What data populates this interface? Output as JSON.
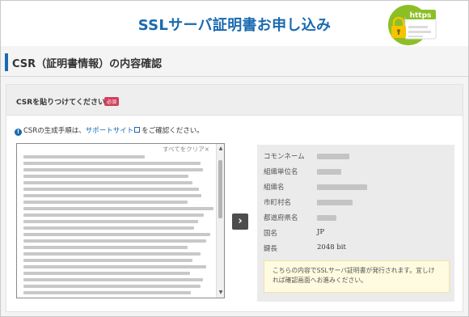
{
  "header": {
    "title": "SSLサーバ証明書お申し込み",
    "badge_text": "https",
    "colors": {
      "brand": "#1a6ab0",
      "badge_green": "#8cbf26"
    }
  },
  "section": {
    "title": "CSR（証明書情報）の内容確認"
  },
  "csr_panel": {
    "label": "CSRを貼りつけてください",
    "required_badge": "必須",
    "info_prefix": "CSRの生成手順は、",
    "info_link": "サポートサイト",
    "info_suffix": "をご確認ください。",
    "clear_all": "すべてをクリア×"
  },
  "arrow_button_label": "›",
  "result": {
    "rows": [
      {
        "label": "コモンネーム",
        "value": ""
      },
      {
        "label": "組織単位名",
        "value": ""
      },
      {
        "label": "組織名",
        "value": ""
      },
      {
        "label": "市町村名",
        "value": ""
      },
      {
        "label": "都道府県名",
        "value": ""
      },
      {
        "label": "国名",
        "value": "JP"
      },
      {
        "label": "鍵長",
        "value": "2048 bit"
      }
    ],
    "notice": "こちらの内容でSSLサーバ証明書が発行されます。宜しければ確認画面へお進みください。"
  },
  "icons": [
    "lock-icon",
    "info-icon",
    "external-link-icon",
    "chevron-right-icon",
    "scroll-up-icon",
    "scroll-down-icon"
  ]
}
